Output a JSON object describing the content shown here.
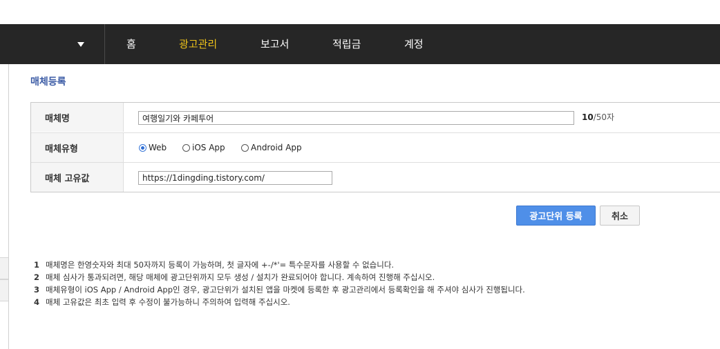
{
  "nav": {
    "items": [
      {
        "label": "홈",
        "active": false
      },
      {
        "label": "광고관리",
        "active": true
      },
      {
        "label": "보고서",
        "active": false
      },
      {
        "label": "적립금",
        "active": false
      },
      {
        "label": "계정",
        "active": false
      }
    ],
    "background": "#262626",
    "active_color": "#f0c419",
    "dropdown_icon": "caret-down-icon"
  },
  "page": {
    "title": "매체등록",
    "title_color": "#3b5ba5"
  },
  "form": {
    "name": {
      "label": "매체명",
      "value": "여행일기와 카페투어",
      "count": "10",
      "count_suffix": "/50자"
    },
    "type": {
      "label": "매체유형",
      "options": [
        {
          "label": "Web",
          "checked": true
        },
        {
          "label": "iOS App",
          "checked": false
        },
        {
          "label": "Android App",
          "checked": false
        }
      ]
    },
    "unique_value": {
      "label": "매체 고유값",
      "value": "https://1dingding.tistory.com/"
    }
  },
  "buttons": {
    "submit_label": "광고단위 등록",
    "cancel_label": "취소",
    "primary_color": "#4f8fe8"
  },
  "notes": [
    {
      "num": "1",
      "text": "매체명은 한영숫자와 최대 50자까지 등록이 가능하며, 첫 글자에 +-/*'= 특수문자를 사용할 수 없습니다."
    },
    {
      "num": "2",
      "text": "매체 심사가 통과되려면, 해당 매체에 광고단위까지 모두 생성 / 설치가 완료되어야 합니다. 계속하여 진행해 주십시오."
    },
    {
      "num": "3",
      "text": "매체유형이 iOS App / Android App인 경우, 광고단위가 설치된 앱을 마켓에 등록한 후 광고관리에서 등록확인을 해 주셔야 심사가 진행됩니다."
    },
    {
      "num": "4",
      "text": "매체 고유값은 최초 입력 후 수정이 불가능하니 주의하여 입력해 주십시오."
    }
  ]
}
